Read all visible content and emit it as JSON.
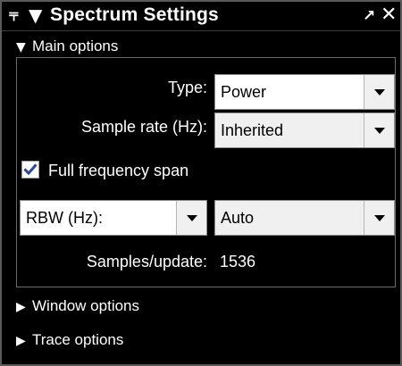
{
  "window": {
    "title": "Spectrum Settings",
    "pin_glyph": "⫧",
    "collapse_glyph": "▼",
    "undock_glyph": "↗",
    "close_glyph": "✕"
  },
  "sections": {
    "main": {
      "label": "Main options",
      "expanded": true,
      "glyph": "▼"
    },
    "window": {
      "label": "Window options",
      "expanded": false,
      "glyph": "▶"
    },
    "trace": {
      "label": "Trace options",
      "expanded": false,
      "glyph": "▶"
    }
  },
  "main_options": {
    "type_label": "Type:",
    "type_value": "Power",
    "sample_rate_label": "Sample rate (Hz):",
    "sample_rate_value": "Inherited",
    "full_span_label": "Full frequency span",
    "full_span_checked": true,
    "rbw_mode_value": "RBW (Hz):",
    "rbw_value": "Auto",
    "samples_label": "Samples/update:",
    "samples_value": "1536"
  },
  "colors": {
    "background": "#000000",
    "text": "#ffffff",
    "check": "#2b4a9c"
  }
}
